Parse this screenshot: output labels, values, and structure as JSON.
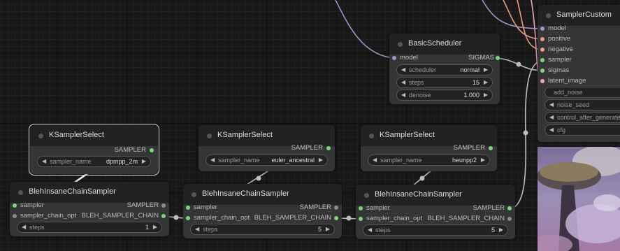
{
  "colors": {
    "canvas": "#181818",
    "node_body": "#353535",
    "node_title": "#222222",
    "link_sigmas": "#bdbdbd",
    "link_model": "#a78fc9",
    "link_conditioning": "#e8a07a",
    "slot_sampler": "#7dd674"
  },
  "nodes": {
    "sampler_custom": {
      "title": "SamplerCustom",
      "inputs": [
        "model",
        "positive",
        "negative",
        "sampler",
        "sigmas",
        "latent_image"
      ],
      "widgets": {
        "add_noise": "add_noise",
        "noise_seed": "noise_seed",
        "control_after_generate": "control_after_generate",
        "cfg": "cfg"
      }
    },
    "basic_scheduler": {
      "title": "BasicScheduler",
      "input_model": "model",
      "output_sigmas": "SIGMAS",
      "widgets": [
        {
          "label": "scheduler",
          "value": "normal"
        },
        {
          "label": "steps",
          "value": "15"
        },
        {
          "label": "denoise",
          "value": "1.000"
        }
      ]
    },
    "ksampler_select_1": {
      "title": "KSamplerSelect",
      "output": "SAMPLER",
      "widget": {
        "label": "sampler_name",
        "value": "dpmpp_2m"
      }
    },
    "ksampler_select_2": {
      "title": "KSamplerSelect",
      "output": "SAMPLER",
      "widget": {
        "label": "sampler_name",
        "value": "euler_ancestral"
      }
    },
    "ksampler_select_3": {
      "title": "KSamplerSelect",
      "output": "SAMPLER",
      "widget": {
        "label": "sampler_name",
        "value": "heunpp2"
      }
    },
    "bleh_chain_1": {
      "title": "BlehInsaneChainSampler",
      "in_sampler": "sampler",
      "in_chain": "sampler_chain_opt",
      "out_sampler": "SAMPLER",
      "out_chain": "BLEH_SAMPLER_CHAIN",
      "widget": {
        "label": "steps",
        "value": "1"
      }
    },
    "bleh_chain_2": {
      "title": "BlehInsaneChainSampler",
      "in_sampler": "sampler",
      "in_chain": "sampler_chain_opt",
      "out_sampler": "SAMPLER",
      "out_chain": "BLEH_SAMPLER_CHAIN",
      "widget": {
        "label": "steps",
        "value": "5"
      }
    },
    "bleh_chain_3": {
      "title": "BlehInsaneChainSampler",
      "in_sampler": "sampler",
      "in_chain": "sampler_chain_opt",
      "out_sampler": "SAMPLER",
      "out_chain": "BLEH_SAMPLER_CHAIN",
      "widget": {
        "label": "steps",
        "value": "5"
      }
    }
  },
  "preview": {
    "subject": "purple-mushroom-landscape"
  }
}
